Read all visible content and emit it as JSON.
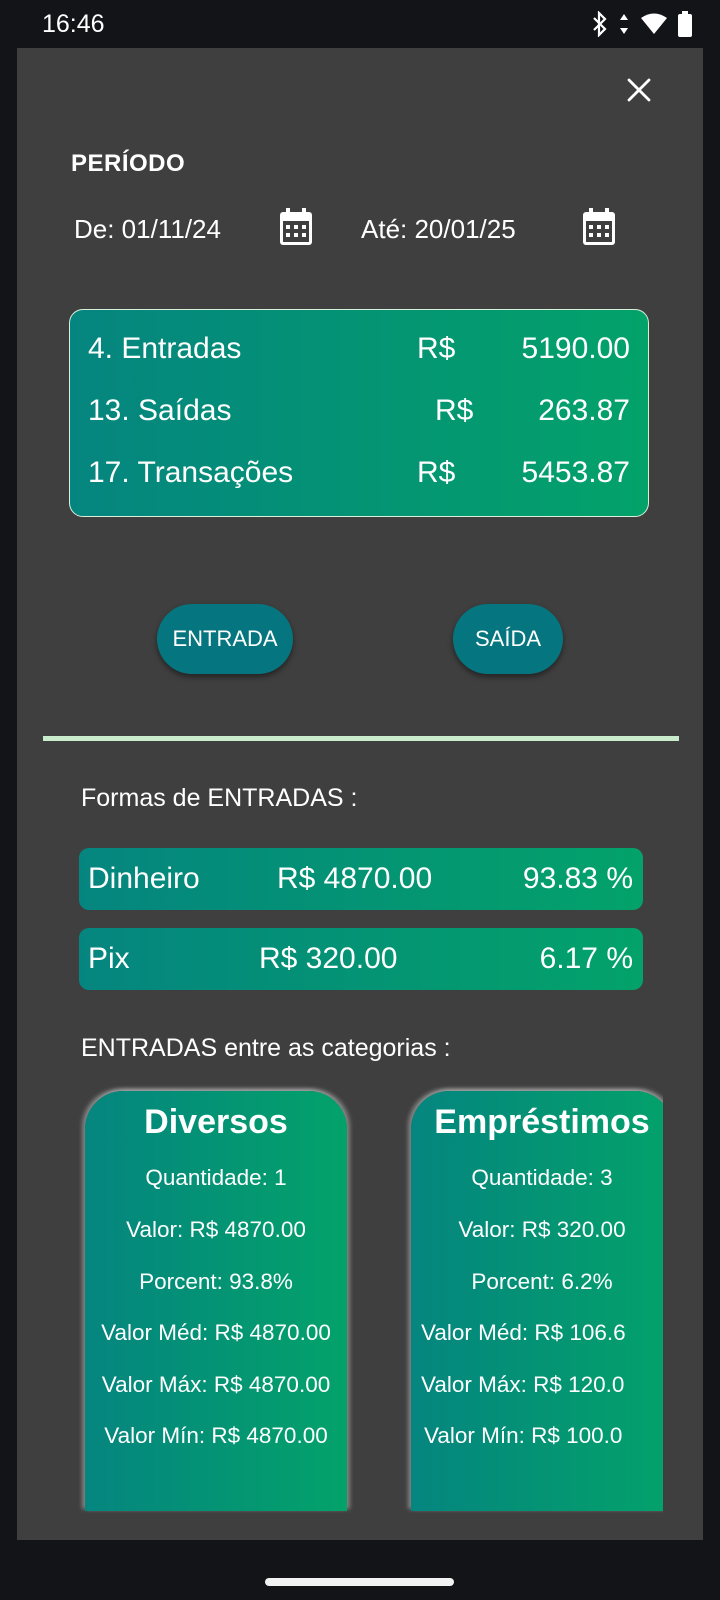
{
  "status_bar": {
    "time": "16:46",
    "icons": [
      "bluetooth-icon",
      "data-arrows-icon",
      "wifi-icon",
      "battery-icon"
    ]
  },
  "dialog": {
    "close_icon": "close-icon",
    "period": {
      "label": "PERÍODO",
      "from": "De: 01/11/24",
      "to": "Até: 20/01/25",
      "calendar_icon": "calendar-icon"
    },
    "summary": {
      "rows": [
        {
          "label": "4. Entradas",
          "currency": "R$",
          "value": "5190.00"
        },
        {
          "label": "13. Saídas",
          "currency": "R$",
          "value": "263.87"
        },
        {
          "label": "17. Transações",
          "currency": "R$",
          "value": "5453.87"
        }
      ]
    },
    "buttons": {
      "entrada": "ENTRADA",
      "saida": "SAÍDA"
    },
    "methods": {
      "title": "Formas de ENTRADAS :",
      "items": [
        {
          "name": "Dinheiro",
          "amount": "R$ 4870.00",
          "percent": "93.83 %"
        },
        {
          "name": "Pix",
          "amount": "R$ 320.00",
          "percent": "6.17 %"
        }
      ]
    },
    "categories": {
      "title": "ENTRADAS entre as categorias :",
      "items": [
        {
          "name": "Diversos",
          "quantity": "Quantidade: 1",
          "value": "Valor: R$ 4870.00",
          "percent": "Porcent: 93.8%",
          "avg": "Valor Méd: R$ 4870.00",
          "max": "Valor Máx: R$ 4870.00",
          "min": "Valor Mín: R$ 4870.00"
        },
        {
          "name": "Empréstimos",
          "quantity": "Quantidade: 3",
          "value": "Valor: R$ 320.00",
          "percent": "Porcent: 6.2%",
          "avg": "Valor Méd: R$ 106.6",
          "max": "Valor Máx: R$ 120.0",
          "min": "Valor Mín: R$ 100.0"
        }
      ]
    }
  },
  "colors": {
    "dialog_bg": "#3f3f3f",
    "gradient_start": "#05857f",
    "gradient_end": "#03a26a",
    "button_bg": "#05757f",
    "divider": "#c9eccc"
  }
}
